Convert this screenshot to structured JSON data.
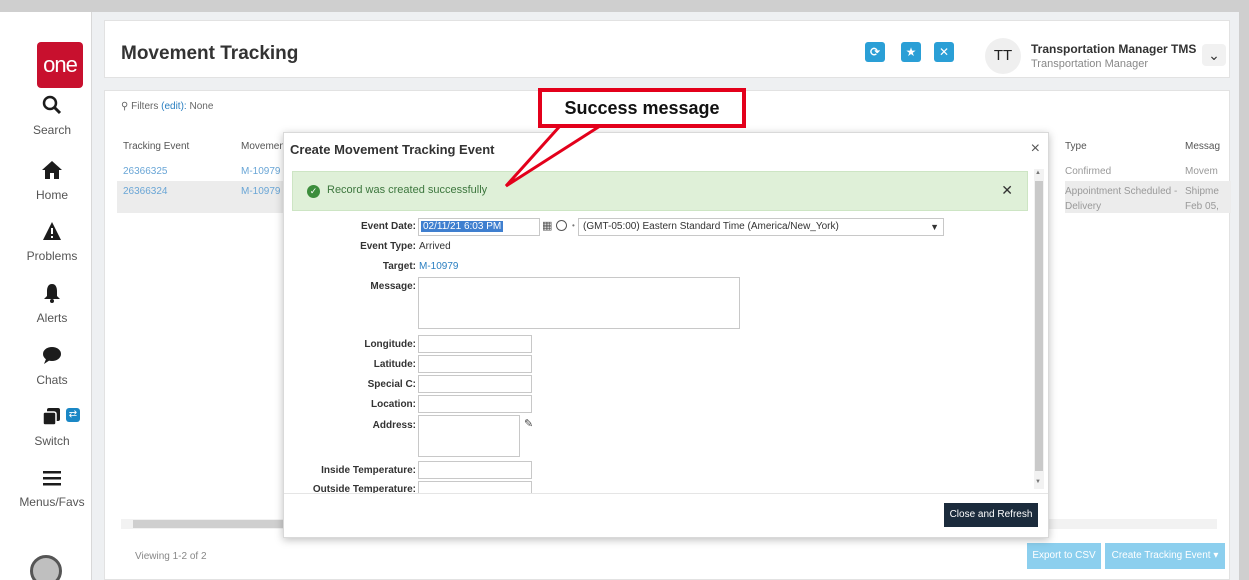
{
  "sidebar": {
    "logo_text": "one",
    "items": [
      {
        "label": "Search",
        "icon": "search-icon"
      },
      {
        "label": "Home",
        "icon": "home-icon"
      },
      {
        "label": "Problems",
        "icon": "warning-icon"
      },
      {
        "label": "Alerts",
        "icon": "bell-icon"
      },
      {
        "label": "Chats",
        "icon": "chat-icon"
      },
      {
        "label": "Switch",
        "icon": "switch-icon"
      },
      {
        "label": "Menus/Favs",
        "icon": "menu-icon"
      }
    ]
  },
  "header": {
    "title": "Movement Tracking",
    "buttons": [
      {
        "icon": "refresh-icon",
        "glyph": "⟳"
      },
      {
        "icon": "star-icon",
        "glyph": "★"
      },
      {
        "icon": "close-icon",
        "glyph": "✕"
      }
    ],
    "avatar_initials": "TT",
    "user_name": "Transportation Manager TMS",
    "user_role": "Transportation Manager",
    "dropdown_glyph": "⌄"
  },
  "filters": {
    "label": "Filters",
    "edit": "(edit):",
    "value": "None"
  },
  "table": {
    "columns_left": [
      "Tracking Event",
      "Movemen"
    ],
    "columns_right": [
      "Type",
      "Messag"
    ],
    "rows": [
      {
        "event": "26366325",
        "movement": "M-10979",
        "type": "Confirmed",
        "message": "Movem"
      },
      {
        "event": "26366324",
        "movement": "M-10979",
        "type": "Appointment Scheduled -",
        "type2": "Delivery",
        "message": "Shipme",
        "message2": "Feb 05,"
      }
    ]
  },
  "footer": {
    "viewing": "Viewing 1-2 of 2",
    "export_label": "Export to CSV",
    "create_label": "Create Tracking Event ▾"
  },
  "annotation": {
    "label": "Success message"
  },
  "modal": {
    "title": "Create Movement Tracking Event",
    "close_glyph": "×",
    "success_message": "Record was created successfully",
    "success_close": "✕",
    "fields": {
      "event_date_label": "Event Date:",
      "event_date_value": "02/11/21 6:03 PM",
      "timezone": "(GMT-05:00) Eastern Standard Time (America/New_York)",
      "event_type_label": "Event Type:",
      "event_type_value": "Arrived",
      "target_label": "Target:",
      "target_value": "M-10979",
      "message_label": "Message:",
      "longitude_label": "Longitude:",
      "latitude_label": "Latitude:",
      "special_label": "Special C:",
      "location_label": "Location:",
      "address_label": "Address:",
      "inside_temp_label": "Inside Temperature:",
      "outside_temp_label": "Outside Temperature:"
    },
    "close_refresh_label": "Close and Refresh"
  }
}
